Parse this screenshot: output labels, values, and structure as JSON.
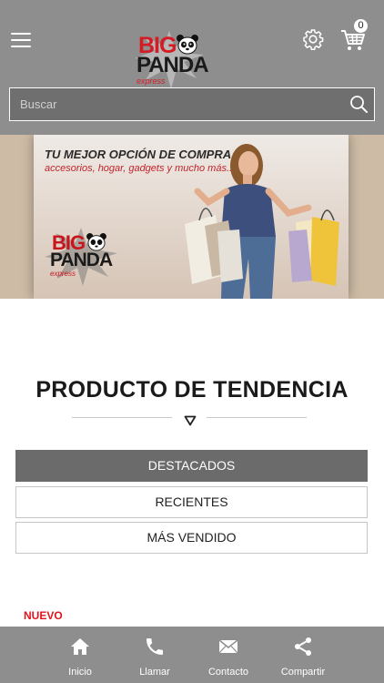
{
  "header": {
    "logo": {
      "big": "BIG",
      "panda": "PANDA",
      "express": "express"
    },
    "cart_count": "0",
    "icons": {
      "menu": "hamburger-menu-icon",
      "settings": "gear-icon",
      "cart": "shopping-cart-icon"
    }
  },
  "search": {
    "placeholder": "Buscar",
    "value": "",
    "icon": "search-icon"
  },
  "banner": {
    "headline": "TU MEJOR OPCIÓN DE COMPRA",
    "subline": "accesorios, hogar, gadgets y mucho más...",
    "logo": {
      "big": "BIG",
      "panda": "PANDA",
      "express": "express"
    }
  },
  "trending": {
    "title": "PRODUCTO DE TENDENCIA",
    "tabs": [
      {
        "label": "DESTACADOS",
        "active": true
      },
      {
        "label": "RECIENTES",
        "active": false
      },
      {
        "label": "MÁS VENDIDO",
        "active": false
      }
    ]
  },
  "products": {
    "first_badge": "NUEVO"
  },
  "bottom_nav": [
    {
      "label": "Inicio",
      "icon": "home-icon"
    },
    {
      "label": "Llamar",
      "icon": "phone-icon"
    },
    {
      "label": "Contacto",
      "icon": "mail-icon"
    },
    {
      "label": "Compartir",
      "icon": "share-icon"
    }
  ],
  "colors": {
    "header_bg": "#8e8e8e",
    "active_tab_bg": "#6b6b6b",
    "brand_red": "#d31c24",
    "badge_red": "#e0141c"
  }
}
